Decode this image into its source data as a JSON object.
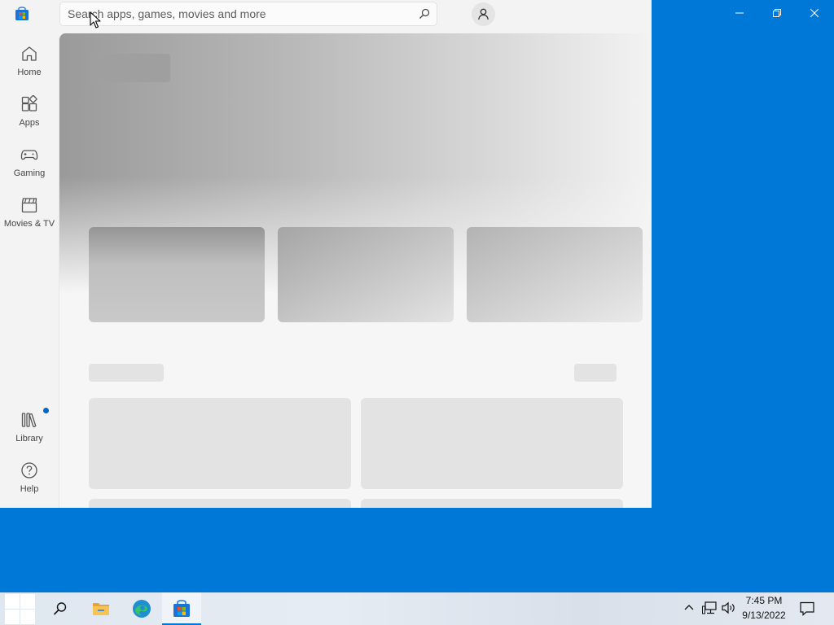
{
  "search": {
    "placeholder": "Search apps, games, movies and more"
  },
  "nav": {
    "items": [
      {
        "label": "Home",
        "icon": "home-icon"
      },
      {
        "label": "Apps",
        "icon": "apps-icon"
      },
      {
        "label": "Gaming",
        "icon": "gaming-icon"
      },
      {
        "label": "Movies & TV",
        "icon": "movies-icon"
      }
    ],
    "bottom": [
      {
        "label": "Library",
        "icon": "library-icon"
      },
      {
        "label": "Help",
        "icon": "help-icon"
      }
    ]
  },
  "taskbar": {
    "time": "7:45 PM",
    "date": "9/13/2022",
    "apps": [
      "start-icon",
      "search-icon",
      "file-explorer-icon",
      "edge-icon",
      "microsoft-store-icon"
    ]
  },
  "colors": {
    "desktop": "#0078d7",
    "accent": "#0067c0"
  }
}
